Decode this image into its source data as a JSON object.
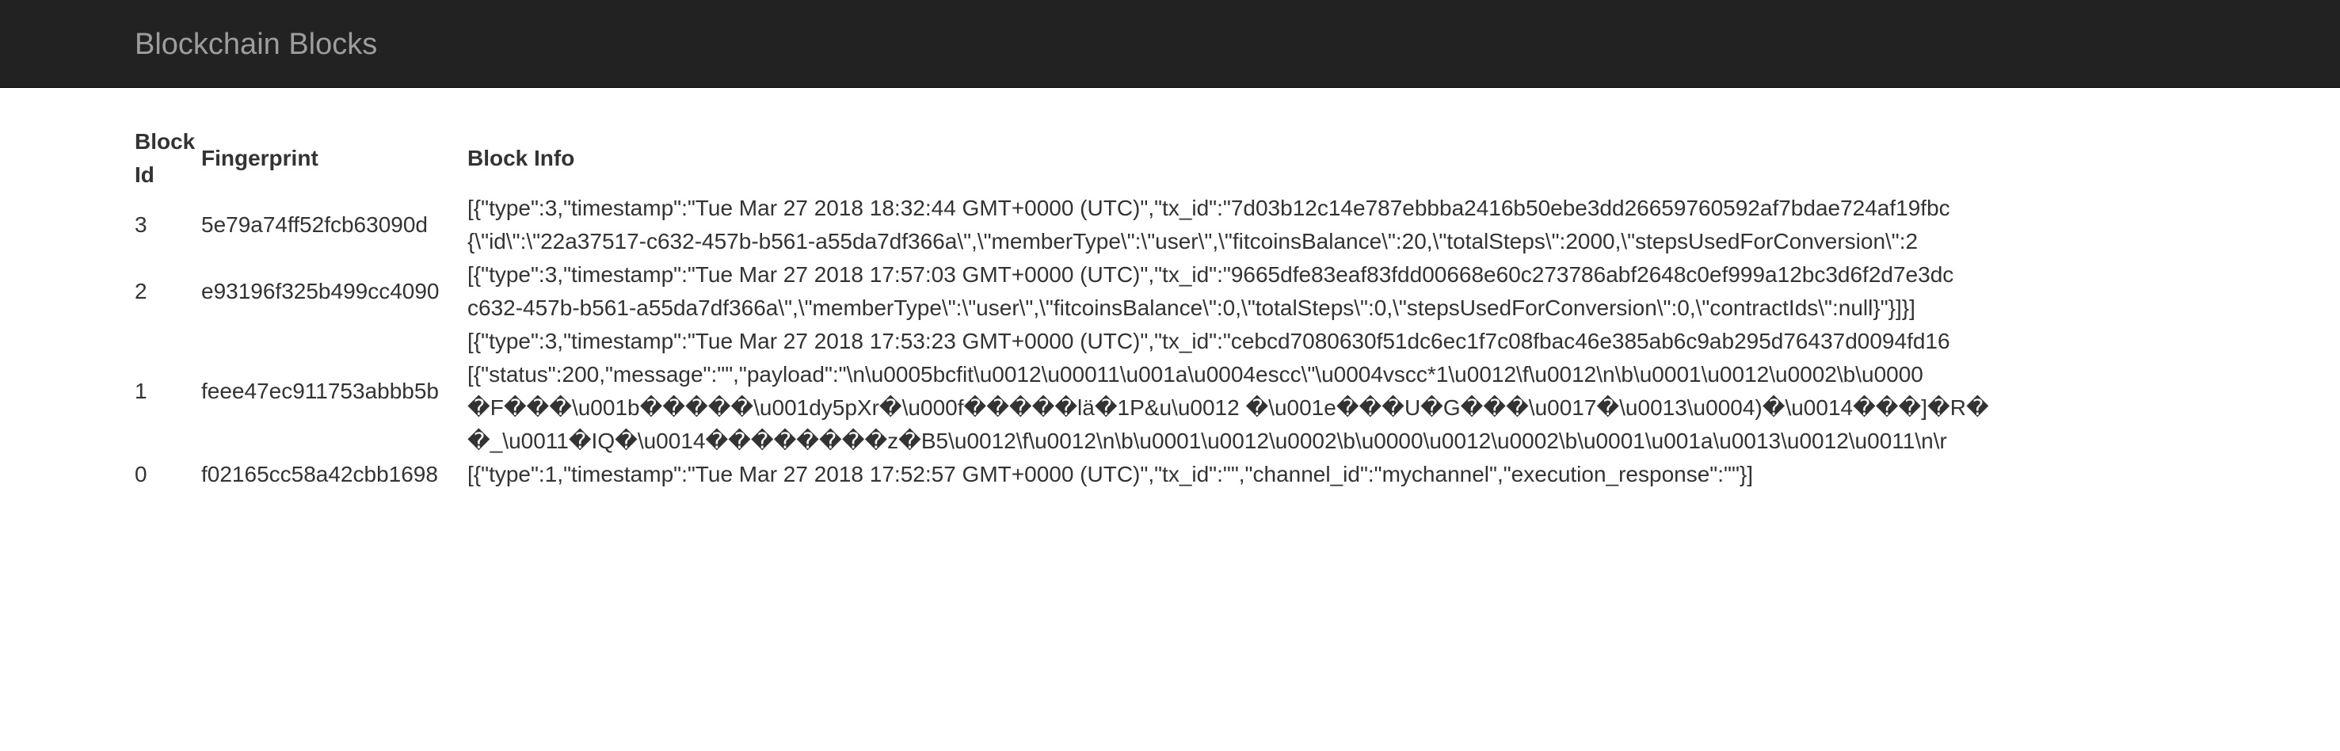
{
  "navbar": {
    "brand": "Blockchain Blocks"
  },
  "table": {
    "headers": {
      "block_id": "Block Id",
      "fingerprint": "Fingerprint",
      "block_info": "Block Info"
    },
    "rows": [
      {
        "id": "3",
        "fingerprint": "5e79a74ff52fcb63090d",
        "info_lines": [
          "[{\"type\":3,\"timestamp\":\"Tue Mar 27 2018 18:32:44 GMT+0000 (UTC)\",\"tx_id\":\"7d03b12c14e787ebbba2416b50ebe3dd26659760592af7bdae724af19fbc",
          "{\\\"id\\\":\\\"22a37517-c632-457b-b561-a55da7df366a\\\",\\\"memberType\\\":\\\"user\\\",\\\"fitcoinsBalance\\\":20,\\\"totalSteps\\\":2000,\\\"stepsUsedForConversion\\\":2"
        ]
      },
      {
        "id": "2",
        "fingerprint": "e93196f325b499cc4090",
        "info_lines": [
          "[{\"type\":3,\"timestamp\":\"Tue Mar 27 2018 17:57:03 GMT+0000 (UTC)\",\"tx_id\":\"9665dfe83eaf83fdd00668e60c273786abf2648c0ef999a12bc3d6f2d7e3dc",
          "c632-457b-b561-a55da7df366a\\\",\\\"memberType\\\":\\\"user\\\",\\\"fitcoinsBalance\\\":0,\\\"totalSteps\\\":0,\\\"stepsUsedForConversion\\\":0,\\\"contractIds\\\":null}\"}]}]"
        ]
      },
      {
        "id": "1",
        "fingerprint": "feee47ec911753abbb5b",
        "info_lines": [
          "[{\"type\":3,\"timestamp\":\"Tue Mar 27 2018 17:53:23 GMT+0000 (UTC)\",\"tx_id\":\"cebcd7080630f51dc6ec1f7c08fbac46e385ab6c9ab295d76437d0094fd16",
          "[{\"status\":200,\"message\":\"\",\"payload\":\"\\n\\u0005bcfit\\u0012\\u00011\\u001a\\u0004escc\\\"\\u0004vscc*1\\u0012\\f\\u0012\\n\\b\\u0001\\u0012\\u0002\\b\\u0000",
          "�F���\\u001b�����\\u001dy5pXr�\\u000f�����lä�1P&u\\u0012 �\\u001e���U�G���\\u0017�\\u0013\\u0004)�\\u0014���]�R�",
          "�_\\u0011�IQ�\\u0014��������z�B5\\u0012\\f\\u0012\\n\\b\\u0001\\u0012\\u0002\\b\\u0000\\u0012\\u0002\\b\\u0001\\u001a\\u0013\\u0012\\u0011\\n\\r"
        ]
      },
      {
        "id": "0",
        "fingerprint": "f02165cc58a42cbb1698",
        "info_lines": [
          "[{\"type\":1,\"timestamp\":\"Tue Mar 27 2018 17:52:57 GMT+0000 (UTC)\",\"tx_id\":\"\",\"channel_id\":\"mychannel\",\"execution_response\":\"\"}]"
        ]
      }
    ]
  }
}
